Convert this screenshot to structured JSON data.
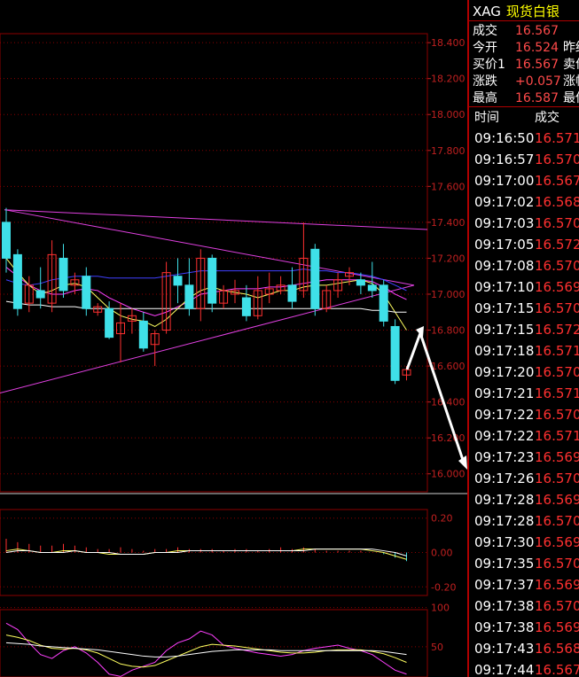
{
  "quote": {
    "symbol": "XAG",
    "name": "现货白银",
    "rows": [
      {
        "label": "成交",
        "value": "16.567",
        "label2": ""
      },
      {
        "label": "今开",
        "value": "16.524",
        "label2": "昨结"
      },
      {
        "label": "买价1",
        "value": "16.567",
        "label2": "卖价"
      },
      {
        "label": "涨跌",
        "value": "+0.057",
        "label2": "涨幅"
      },
      {
        "label": "最高",
        "value": "16.587",
        "label2": "最低"
      }
    ]
  },
  "ticks_header": {
    "time": "时间",
    "price": "成交"
  },
  "ticks": [
    {
      "time": "09:16:50",
      "price": "16.571"
    },
    {
      "time": "09:16:57",
      "price": "16.570"
    },
    {
      "time": "09:17:00",
      "price": "16.567"
    },
    {
      "time": "09:17:02",
      "price": "16.568"
    },
    {
      "time": "09:17:03",
      "price": "16.570"
    },
    {
      "time": "09:17:05",
      "price": "16.572"
    },
    {
      "time": "09:17:08",
      "price": "16.570"
    },
    {
      "time": "09:17:10",
      "price": "16.569"
    },
    {
      "time": "09:17:15",
      "price": "16.570"
    },
    {
      "time": "09:17:15",
      "price": "16.572"
    },
    {
      "time": "09:17:18",
      "price": "16.571"
    },
    {
      "time": "09:17:20",
      "price": "16.570"
    },
    {
      "time": "09:17:21",
      "price": "16.571"
    },
    {
      "time": "09:17:22",
      "price": "16.570"
    },
    {
      "time": "09:17:22",
      "price": "16.571"
    },
    {
      "time": "09:17:23",
      "price": "16.569"
    },
    {
      "time": "09:17:26",
      "price": "16.570"
    },
    {
      "time": "09:17:28",
      "price": "16.569"
    },
    {
      "time": "09:17:28",
      "price": "16.570"
    },
    {
      "time": "09:17:30",
      "price": "16.569"
    },
    {
      "time": "09:17:35",
      "price": "16.570"
    },
    {
      "time": "09:17:37",
      "price": "16.569"
    },
    {
      "time": "09:17:38",
      "price": "16.570"
    },
    {
      "time": "09:17:38",
      "price": "16.569"
    },
    {
      "time": "09:17:43",
      "price": "16.568"
    },
    {
      "time": "09:17:44",
      "price": "16.567"
    }
  ],
  "colors": {
    "up": "#ff3030",
    "down": "#3fe0e8",
    "grid": "#8b0000",
    "axis": "#c02020"
  },
  "chart_data": [
    {
      "type": "candlestick",
      "title": "",
      "ylim": [
        15.9,
        18.45
      ],
      "y_ticks": [
        "18.400",
        "18.200",
        "18.000",
        "17.800",
        "17.600",
        "17.400",
        "17.200",
        "17.000",
        "16.800",
        "16.600",
        "16.400",
        "16.200",
        "16.000"
      ],
      "grid": true,
      "candles": [
        {
          "o": 17.4,
          "h": 17.48,
          "l": 17.12,
          "c": 17.2
        },
        {
          "o": 17.22,
          "h": 17.25,
          "l": 16.88,
          "c": 16.92
        },
        {
          "o": 16.95,
          "h": 17.1,
          "l": 16.9,
          "c": 17.05
        },
        {
          "o": 17.02,
          "h": 17.15,
          "l": 16.92,
          "c": 16.98
        },
        {
          "o": 16.95,
          "h": 17.3,
          "l": 16.9,
          "c": 17.22
        },
        {
          "o": 17.2,
          "h": 17.28,
          "l": 16.98,
          "c": 17.02
        },
        {
          "o": 17.05,
          "h": 17.12,
          "l": 17.0,
          "c": 17.08
        },
        {
          "o": 17.1,
          "h": 17.15,
          "l": 16.88,
          "c": 16.92
        },
        {
          "o": 16.9,
          "h": 16.95,
          "l": 16.88,
          "c": 16.93
        },
        {
          "o": 16.92,
          "h": 16.96,
          "l": 16.75,
          "c": 16.76
        },
        {
          "o": 16.78,
          "h": 16.95,
          "l": 16.62,
          "c": 16.84
        },
        {
          "o": 16.85,
          "h": 16.92,
          "l": 16.78,
          "c": 16.88
        },
        {
          "o": 16.85,
          "h": 16.9,
          "l": 16.68,
          "c": 16.7
        },
        {
          "o": 16.72,
          "h": 16.8,
          "l": 16.6,
          "c": 16.78
        },
        {
          "o": 16.8,
          "h": 17.18,
          "l": 16.78,
          "c": 17.12
        },
        {
          "o": 17.1,
          "h": 17.2,
          "l": 16.95,
          "c": 17.05
        },
        {
          "o": 17.05,
          "h": 17.2,
          "l": 16.88,
          "c": 16.92
        },
        {
          "o": 16.92,
          "h": 17.25,
          "l": 16.85,
          "c": 17.2
        },
        {
          "o": 17.2,
          "h": 17.22,
          "l": 16.9,
          "c": 16.95
        },
        {
          "o": 16.95,
          "h": 17.05,
          "l": 16.92,
          "c": 17.02
        },
        {
          "o": 17.0,
          "h": 17.08,
          "l": 16.95,
          "c": 17.02
        },
        {
          "o": 16.98,
          "h": 17.05,
          "l": 16.85,
          "c": 16.88
        },
        {
          "o": 16.88,
          "h": 17.1,
          "l": 16.86,
          "c": 17.02
        },
        {
          "o": 17.0,
          "h": 17.12,
          "l": 16.95,
          "c": 17.03
        },
        {
          "o": 17.02,
          "h": 17.1,
          "l": 17.0,
          "c": 17.05
        },
        {
          "o": 17.05,
          "h": 17.15,
          "l": 16.92,
          "c": 16.96
        },
        {
          "o": 17.02,
          "h": 17.4,
          "l": 16.98,
          "c": 17.2
        },
        {
          "o": 17.25,
          "h": 17.28,
          "l": 16.88,
          "c": 16.92
        },
        {
          "o": 16.92,
          "h": 17.05,
          "l": 16.9,
          "c": 17.02
        },
        {
          "o": 17.02,
          "h": 17.12,
          "l": 16.98,
          "c": 17.08
        },
        {
          "o": 17.1,
          "h": 17.15,
          "l": 17.05,
          "c": 17.12
        },
        {
          "o": 17.08,
          "h": 17.12,
          "l": 17.0,
          "c": 17.05
        },
        {
          "o": 17.05,
          "h": 17.18,
          "l": 16.98,
          "c": 17.02
        },
        {
          "o": 17.05,
          "h": 17.08,
          "l": 16.82,
          "c": 16.85
        },
        {
          "o": 16.82,
          "h": 16.86,
          "l": 16.5,
          "c": 16.52
        },
        {
          "o": 16.55,
          "h": 16.6,
          "l": 16.52,
          "c": 16.58
        }
      ],
      "ma_series": [
        {
          "color": "#4040ff",
          "values": [
            17.08,
            17.06,
            17.05,
            17.06,
            17.08,
            17.09,
            17.1,
            17.1,
            17.1,
            17.09,
            17.09,
            17.09,
            17.09,
            17.09,
            17.1,
            17.11,
            17.12,
            17.13,
            17.13,
            17.13,
            17.13,
            17.13,
            17.13,
            17.13,
            17.13,
            17.13,
            17.14,
            17.13,
            17.13,
            17.12,
            17.12,
            17.11,
            17.1,
            17.08,
            17.05,
            17.02
          ]
        },
        {
          "color": "#ff40ff",
          "values": [
            17.15,
            17.1,
            17.05,
            17.02,
            17.0,
            17.0,
            17.02,
            17.03,
            17.02,
            16.98,
            16.95,
            16.92,
            16.9,
            16.88,
            16.9,
            16.93,
            16.96,
            17.0,
            17.01,
            17.02,
            17.03,
            17.03,
            17.03,
            17.04,
            17.04,
            17.05,
            17.06,
            17.07,
            17.08,
            17.08,
            17.08,
            17.08,
            17.07,
            17.04,
            17.0,
            16.97
          ]
        },
        {
          "color": "#ffff60",
          "values": [
            17.2,
            17.12,
            17.05,
            17.0,
            17.02,
            17.05,
            17.06,
            17.04,
            16.98,
            16.92,
            16.88,
            16.86,
            16.85,
            16.82,
            16.86,
            16.92,
            16.98,
            17.02,
            17.04,
            17.02,
            17.01,
            17.0,
            16.98,
            17.0,
            17.02,
            17.02,
            17.04,
            17.05,
            17.05,
            17.06,
            17.07,
            17.08,
            17.06,
            17.0,
            16.9,
            16.8
          ]
        },
        {
          "color": "#ffffff",
          "values": [
            16.96,
            16.95,
            16.94,
            16.94,
            16.93,
            16.93,
            16.93,
            16.92,
            16.92,
            16.92,
            16.92,
            16.92,
            16.92,
            16.92,
            16.92,
            16.92,
            16.92,
            16.92,
            16.92,
            16.92,
            16.92,
            16.92,
            16.92,
            16.92,
            16.92,
            16.92,
            16.92,
            16.92,
            16.92,
            16.92,
            16.92,
            16.92,
            16.91,
            16.91,
            16.9,
            16.9
          ]
        }
      ]
    },
    {
      "type": "line",
      "title": "",
      "ylim": [
        -0.25,
        0.25
      ],
      "y_ticks": [
        "0.20",
        "0.00",
        "-0.20"
      ],
      "bars": [
        0.08,
        0.06,
        0.05,
        0.04,
        0.04,
        0.05,
        0.04,
        0.03,
        0.02,
        0.02,
        0.03,
        0.02,
        0.01,
        0.02,
        0.02,
        0.03,
        0.02,
        0.02,
        0.02,
        0.01,
        0.02,
        0.02,
        0.01,
        0.02,
        0.03,
        0.02,
        0.03,
        0.02,
        0.01,
        0.01,
        0.01,
        0.01,
        0.0,
        -0.01,
        -0.03,
        -0.05
      ],
      "series": [
        {
          "color": "#ffff60",
          "values": [
            0.01,
            0.02,
            0.01,
            0.0,
            0.0,
            0.01,
            0.01,
            0.0,
            0.0,
            -0.01,
            -0.01,
            -0.01,
            -0.01,
            0.0,
            0.0,
            0.01,
            0.01,
            0.01,
            0.01,
            0.01,
            0.01,
            0.01,
            0.01,
            0.01,
            0.01,
            0.01,
            0.02,
            0.02,
            0.02,
            0.02,
            0.02,
            0.02,
            0.01,
            0.0,
            -0.02,
            -0.04
          ]
        },
        {
          "color": "#ffffff",
          "values": [
            0.0,
            0.01,
            0.01,
            0.0,
            0.0,
            0.0,
            0.01,
            0.0,
            0.0,
            0.0,
            -0.01,
            -0.01,
            -0.01,
            0.0,
            0.0,
            0.0,
            0.01,
            0.01,
            0.01,
            0.01,
            0.01,
            0.01,
            0.01,
            0.01,
            0.01,
            0.01,
            0.01,
            0.02,
            0.02,
            0.02,
            0.02,
            0.02,
            0.02,
            0.01,
            0.0,
            -0.02
          ]
        }
      ]
    },
    {
      "type": "line",
      "title": "",
      "ylim": [
        0,
        120
      ],
      "y_ticks": [
        "100",
        "50"
      ],
      "series": [
        {
          "color": "#ff40ff",
          "values": [
            80,
            72,
            55,
            40,
            35,
            45,
            50,
            42,
            30,
            15,
            12,
            20,
            25,
            30,
            45,
            55,
            60,
            70,
            65,
            52,
            48,
            45,
            42,
            40,
            38,
            40,
            45,
            48,
            50,
            52,
            48,
            45,
            40,
            30,
            20,
            15
          ]
        },
        {
          "color": "#ffff60",
          "values": [
            65,
            62,
            58,
            52,
            48,
            47,
            48,
            46,
            42,
            35,
            28,
            25,
            24,
            26,
            32,
            38,
            44,
            50,
            53,
            52,
            51,
            49,
            47,
            45,
            43,
            42,
            42,
            43,
            45,
            46,
            46,
            46,
            44,
            41,
            36,
            30
          ]
        },
        {
          "color": "#ffffff",
          "values": [
            55,
            54,
            53,
            51,
            50,
            49,
            48,
            47,
            46,
            44,
            42,
            40,
            38,
            37,
            37,
            38,
            40,
            42,
            44,
            45,
            46,
            46,
            46,
            46,
            45,
            45,
            45,
            45,
            45,
            45,
            45,
            45,
            45,
            44,
            42,
            40
          ]
        }
      ]
    }
  ]
}
